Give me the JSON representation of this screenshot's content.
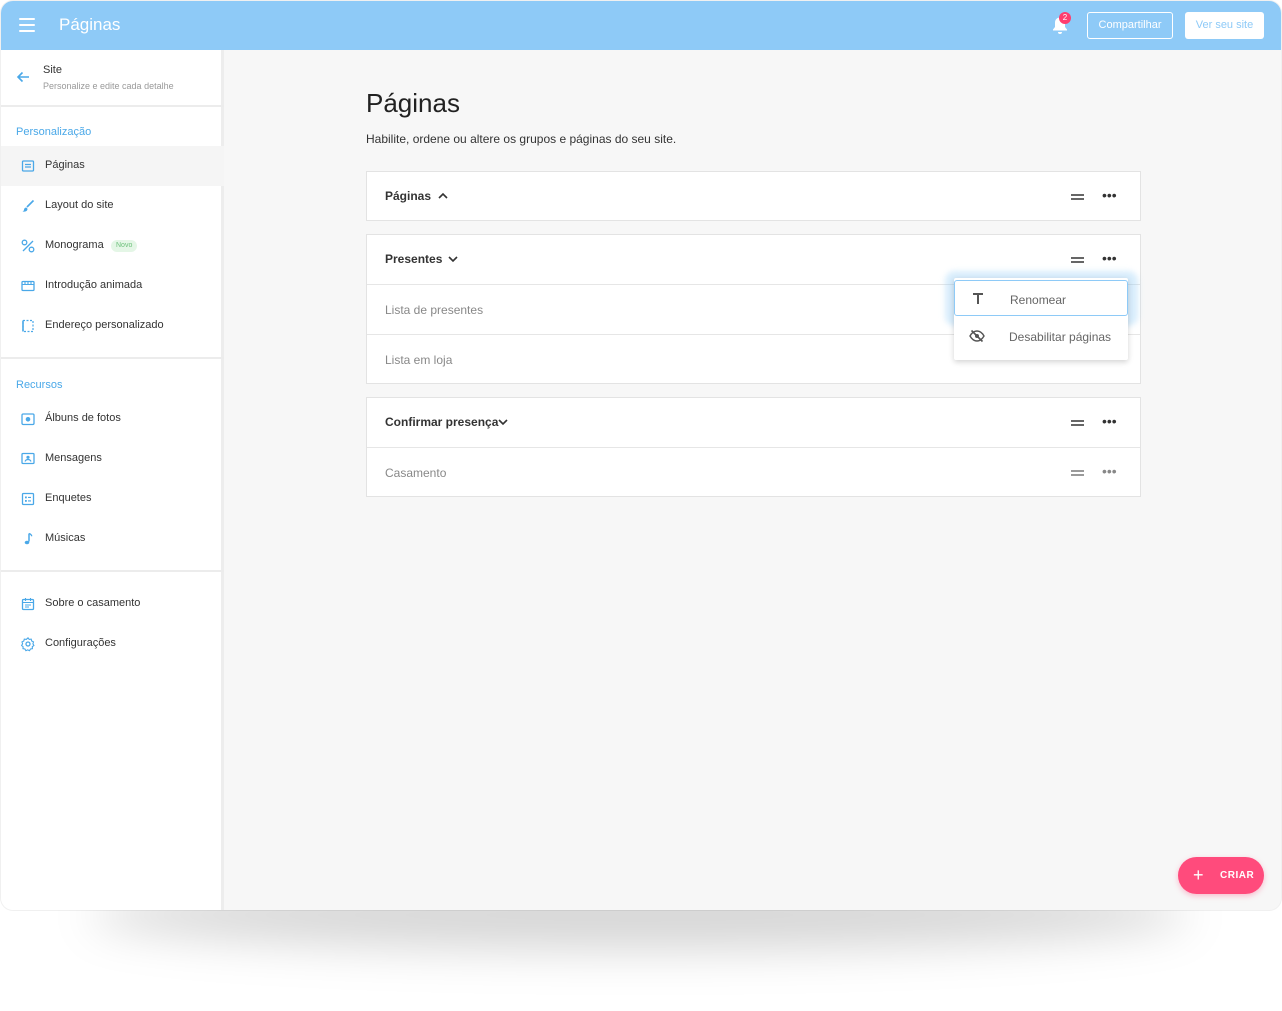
{
  "header": {
    "title": "Páginas",
    "notifications_count": "2",
    "share_label": "Compartilhar",
    "view_site_label": "Ver seu site"
  },
  "sidebar": {
    "site_title": "Site",
    "site_subtitle": "Personalize e edite cada detalhe",
    "sections": [
      {
        "label": "Personalização",
        "items": [
          {
            "label": "Páginas",
            "icon": "page-icon",
            "active": true
          },
          {
            "label": "Layout do site",
            "icon": "brush-icon"
          },
          {
            "label": "Monograma",
            "icon": "percent-icon",
            "tag": "Novo"
          },
          {
            "label": "Introdução animada",
            "icon": "film-icon"
          },
          {
            "label": "Endereço personalizado",
            "icon": "frame-icon"
          }
        ]
      },
      {
        "label": "Recursos",
        "items": [
          {
            "label": "Álbuns de fotos",
            "icon": "camera-icon"
          },
          {
            "label": "Mensagens",
            "icon": "message-icon"
          },
          {
            "label": "Enquetes",
            "icon": "poll-icon"
          },
          {
            "label": "Músicas",
            "icon": "music-note-icon"
          }
        ]
      },
      {
        "label": "",
        "items": [
          {
            "label": "Sobre o casamento",
            "icon": "calendar-icon"
          },
          {
            "label": "Configurações",
            "icon": "gear-icon"
          }
        ]
      }
    ]
  },
  "main": {
    "title": "Páginas",
    "subtitle": "Habilite, ordene ou altere os grupos e páginas do seu site.",
    "groups": [
      {
        "label": "Páginas",
        "expanded": false,
        "pages": []
      },
      {
        "label": "Presentes",
        "expanded": true,
        "pages": [
          "Lista de presentes",
          "Lista em loja"
        ]
      },
      {
        "label": "Confirmar presença",
        "expanded": true,
        "pages": [
          "Casamento"
        ]
      }
    ]
  },
  "context_menu": {
    "items": [
      {
        "label": "Renomear",
        "icon": "text-format-icon"
      },
      {
        "label": "Desabilitar páginas",
        "icon": "eye-off-icon"
      }
    ]
  },
  "fab": {
    "label": "CRIAR"
  },
  "colors": {
    "primary": "#8ecaf7",
    "accent": "#ff4b7c",
    "section_label": "#4aa8e8",
    "new_tag": "#6cc07a"
  }
}
